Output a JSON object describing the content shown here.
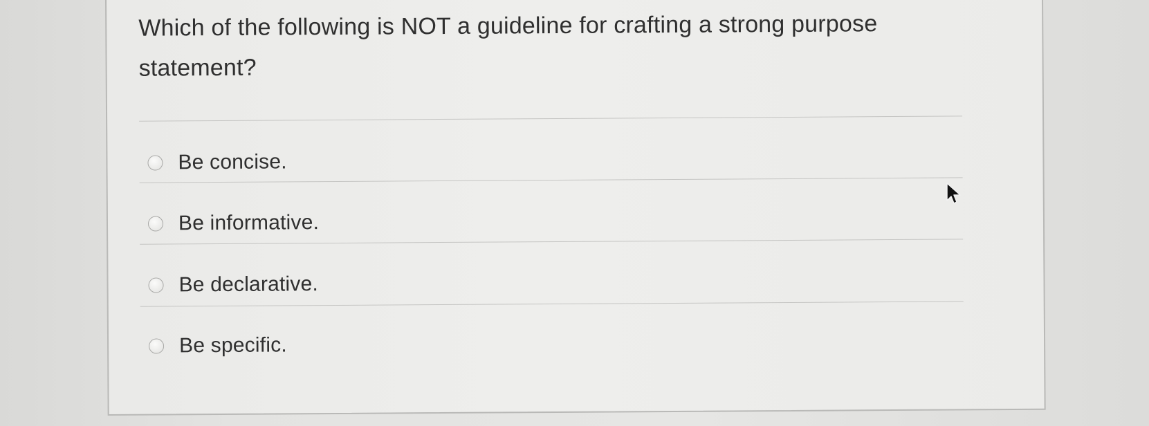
{
  "question": {
    "text": "Which of the following is NOT a guideline for crafting a strong purpose statement?"
  },
  "options": [
    {
      "label": "Be concise.",
      "selected": false
    },
    {
      "label": "Be informative.",
      "selected": false
    },
    {
      "label": "Be declarative.",
      "selected": false
    },
    {
      "label": "Be specific.",
      "selected": false
    }
  ],
  "cursor": {
    "icon": "arrow-cursor-icon"
  }
}
